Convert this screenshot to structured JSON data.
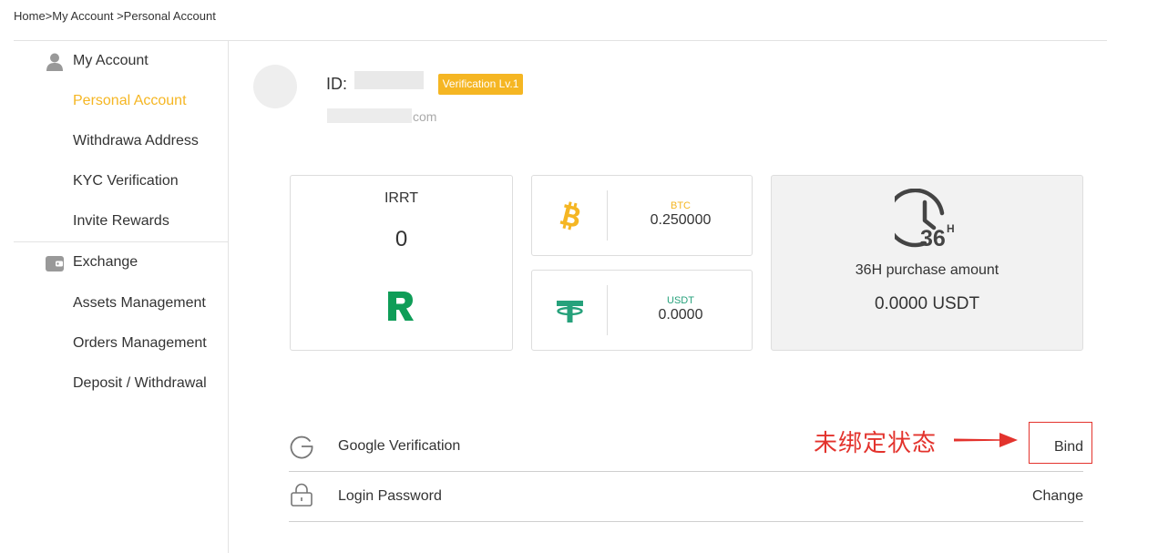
{
  "breadcrumb": "Home>My Account >Personal Account",
  "sidebar": {
    "account_header": "My Account",
    "account_items": [
      "Personal Account",
      "Withdrawa Address",
      "KYC Verification",
      "Invite Rewards"
    ],
    "active_item": "Personal Account",
    "exchange_header": "Exchange",
    "exchange_items": [
      "Assets Management",
      "Orders Management",
      "Deposit / Withdrawal"
    ]
  },
  "profile": {
    "id_label": "ID:",
    "badge": "Verification Lv.1",
    "email_suffix": "com"
  },
  "cards": {
    "irrt": {
      "title": "IRRT",
      "value": "0",
      "logo_icon": "irrt-r-logo"
    },
    "btc": {
      "name": "BTC",
      "value": "0.250000",
      "color": "#f5b623",
      "icon": "bitcoin-icon"
    },
    "usdt": {
      "name": "USDT",
      "value": "0.0000",
      "color": "#26a17b",
      "icon": "tether-icon"
    },
    "purchase": {
      "label": "36H purchase amount",
      "value": "0.0000 USDT",
      "icon": "36h-clock-icon",
      "icon_text": "36",
      "icon_sup": "H"
    }
  },
  "security": [
    {
      "label": "Google Verification",
      "action": "Bind",
      "icon": "google-g-icon"
    },
    {
      "label": "Login Password",
      "action": "Change",
      "icon": "lock-icon"
    }
  ],
  "annotation": {
    "text": "未绑定状态",
    "color": "#e3332d"
  },
  "colors": {
    "accent": "#f5b623",
    "irrt_green": "#0f9d58"
  }
}
